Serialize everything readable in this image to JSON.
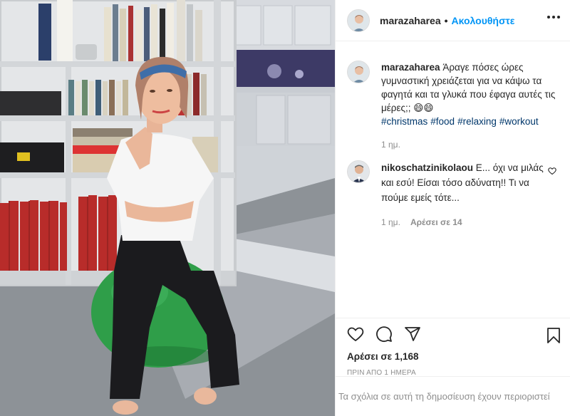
{
  "header": {
    "username": "marazaharea",
    "separator": "•",
    "follow_label": "Ακολουθήστε",
    "more_icon": "more-horizontal-icon"
  },
  "caption": {
    "username": "marazaharea",
    "text": "Άραγε πόσες ώρες γυμναστική χρειάζεται για να κάψω τα φαγητά και τα γλυκά που έφαγα αυτές τις μέρες;; 😄😄",
    "hashtags": [
      "#christmas",
      "#food",
      "#relaxing",
      "#workout"
    ],
    "time": "1 ημ."
  },
  "reply": {
    "username": "nikoschatzinikolaou",
    "text": "Ε... όχι να μιλάς και εσύ! Είσαι τόσο αδύνατη!! Τι να πούμε εμείς τότε...",
    "time": "1 ημ.",
    "likes": "Αρέσει σε 14"
  },
  "actions": {
    "likes": "Αρέσει σε 1,168",
    "date": "ΠΡΙΝ ΑΠΟ 1 ΗΜΕΡΑ"
  },
  "footer": {
    "restricted": "Τα σχόλια σε αυτή τη δημοσίευση έχουν περιοριστεί"
  },
  "colors": {
    "link_blue": "#0095f6",
    "hashtag_blue": "#00376b",
    "muted_gray": "#8e8e8e",
    "ball_green": "#2fa04a"
  }
}
